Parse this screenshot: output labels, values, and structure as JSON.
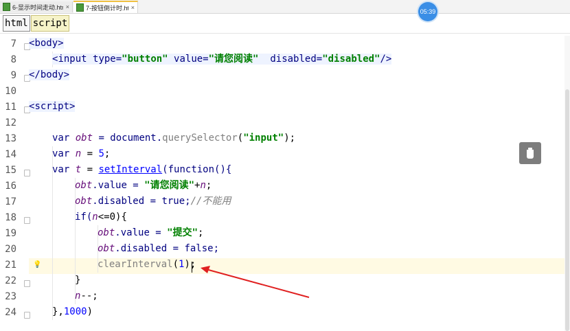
{
  "tabs": [
    {
      "label": "6-显示时间走动.html",
      "close": "×"
    },
    {
      "label": "7-按钮倒计时.html",
      "close": "×"
    }
  ],
  "timer": "05:39",
  "breadcrumb": [
    "html",
    "script"
  ],
  "lines": [
    {
      "n": "7"
    },
    {
      "n": "8"
    },
    {
      "n": "9"
    },
    {
      "n": "10"
    },
    {
      "n": "11"
    },
    {
      "n": "12"
    },
    {
      "n": "13"
    },
    {
      "n": "14"
    },
    {
      "n": "15"
    },
    {
      "n": "16"
    },
    {
      "n": "17"
    },
    {
      "n": "18"
    },
    {
      "n": "19"
    },
    {
      "n": "20"
    },
    {
      "n": "21"
    },
    {
      "n": "22"
    },
    {
      "n": "23"
    },
    {
      "n": "24"
    }
  ],
  "code": {
    "l7": {
      "open": "<",
      "tag": "body",
      "close": ">"
    },
    "l8": {
      "open": "<",
      "tag": "input",
      "a1": " type=",
      "v1": "\"button\"",
      "a2": " value=",
      "v2": "\"请您阅读\"",
      "a3": "  disabled=",
      "v3": "\"disabled\"",
      "end": "/>"
    },
    "l9": {
      "open": "</",
      "tag": "body",
      "close": ">"
    },
    "l11": {
      "open": "<",
      "tag": "script",
      "close": ">"
    },
    "l13": {
      "kw": "var ",
      "var": "obt",
      "eq": " = document.",
      "fn": "querySelector",
      "p1": "(",
      "str": "\"input\"",
      "p2": ");"
    },
    "l14": {
      "kw": "var ",
      "var": "n",
      "eq": " = ",
      "num": "5",
      "semi": ";"
    },
    "l15": {
      "kw": "var ",
      "var": "t",
      "eq": " = ",
      "fn": "setInterval",
      "rest": "(function(){"
    },
    "l16": {
      "var": "obt",
      "a": ".value = ",
      "str": "\"请您阅读\"",
      "b": "+",
      "v2": "n",
      "semi": ";"
    },
    "l17": {
      "var": "obt",
      "a": ".disabled = true;",
      "cmt": "//不能用"
    },
    "l18": {
      "kw": "if(",
      "var": "n",
      "rest": "<=0){"
    },
    "l19": {
      "var": "obt",
      "a": ".value = ",
      "str": "\"提交\"",
      "semi": ";"
    },
    "l20": {
      "var": "obt",
      "a": ".disabled = false;"
    },
    "l21": {
      "fn": "clearInterval",
      "p1": "(",
      "num": "1",
      "p2": ");"
    },
    "l22": {
      "txt": "}"
    },
    "l23": {
      "var": "n",
      "rest": "--;"
    },
    "l24": {
      "a": "},",
      "num": "1000",
      "b": ")"
    }
  },
  "colors": {
    "accent": "#3a8ee6",
    "arrow": "#e02020"
  }
}
